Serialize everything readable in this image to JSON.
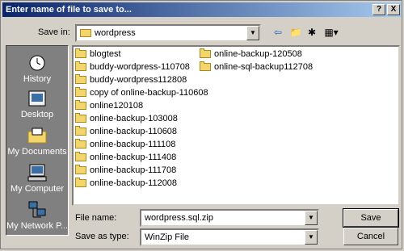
{
  "dialog": {
    "title": "Enter name of file to save to...",
    "help_label": "?",
    "close_label": "X"
  },
  "toolbar": {
    "save_in_label": "Save in:",
    "folder": "wordpress",
    "icons": [
      "back-icon",
      "up-folder-icon",
      "new-folder-icon",
      "view-menu-icon"
    ]
  },
  "places": [
    {
      "label": "History",
      "icon": "history-icon"
    },
    {
      "label": "Desktop",
      "icon": "desktop-icon"
    },
    {
      "label": "My Documents",
      "icon": "my-documents-icon"
    },
    {
      "label": "My Computer",
      "icon": "my-computer-icon"
    },
    {
      "label": "My Network P...",
      "icon": "my-network-icon"
    }
  ],
  "files": {
    "col1": [
      "blogtest",
      "buddy-wordpress-110708",
      "buddy-wordpress112808",
      "copy of online-backup-110608",
      "online120108",
      "online-backup-103008",
      "online-backup-110608",
      "online-backup-111108",
      "online-backup-111408",
      "online-backup-111708",
      "online-backup-112008"
    ],
    "col2": [
      "online-backup-120508",
      "online-sql-backup112708"
    ]
  },
  "form": {
    "file_name_label": "File name:",
    "file_name_value": "wordpress.sql.zip",
    "save_as_type_label": "Save as type:",
    "save_as_type_value": "WinZip File"
  },
  "buttons": {
    "save": "Save",
    "cancel": "Cancel"
  }
}
